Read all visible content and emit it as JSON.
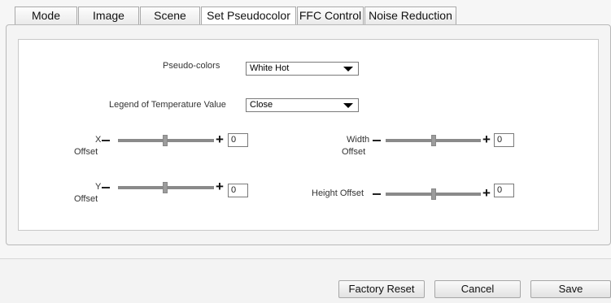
{
  "tabs": [
    {
      "label": "Mode",
      "active": false
    },
    {
      "label": "Image",
      "active": false
    },
    {
      "label": "Scene",
      "active": false
    },
    {
      "label": "Set Pseudocolor",
      "active": true
    },
    {
      "label": "FFC Control",
      "active": false
    },
    {
      "label": "Noise Reduction",
      "active": false
    }
  ],
  "form": {
    "pseudo_colors": {
      "label": "Pseudo-colors",
      "value": "White Hot"
    },
    "legend": {
      "label": "Legend of Temperature Value",
      "value": "Close"
    },
    "x_offset": {
      "label_top": "X",
      "label_bottom": "Offset",
      "value": "0",
      "minus": "-",
      "plus": "+"
    },
    "y_offset": {
      "label_top": "Y",
      "label_bottom": "Offset",
      "value": "0",
      "minus": "-",
      "plus": "+"
    },
    "width_offset": {
      "label_top": "Width",
      "label_bottom": "Offset",
      "value": "0",
      "minus": "-",
      "plus": "+"
    },
    "height_offset": {
      "label_top": "Height Offset",
      "value": "0",
      "minus": "-",
      "plus": "+"
    }
  },
  "buttons": {
    "factory_reset": "Factory Reset",
    "cancel": "Cancel",
    "save": "Save"
  }
}
